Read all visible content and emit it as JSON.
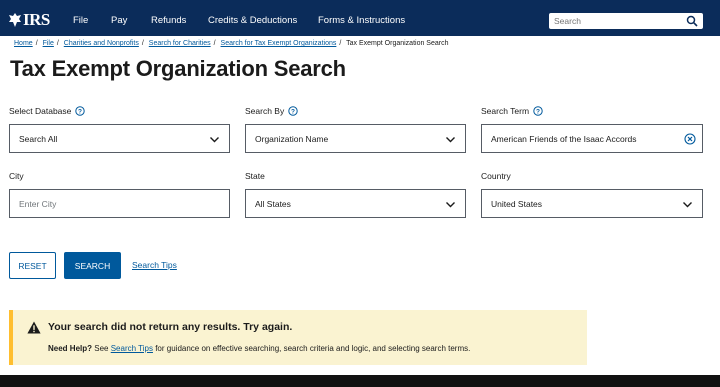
{
  "nav": {
    "logo": "IRS",
    "items": [
      "File",
      "Pay",
      "Refunds",
      "Credits & Deductions",
      "Forms & Instructions"
    ],
    "search_placeholder": "Search"
  },
  "breadcrumb": {
    "items": [
      "Home",
      "File",
      "Charities and Nonprofits",
      "Search for Charities",
      "Search for Tax Exempt Organizations"
    ],
    "current": "Tax Exempt Organization Search"
  },
  "page_title": "Tax Exempt Organization Search",
  "form": {
    "select_database": {
      "label": "Select Database",
      "value": "Search All"
    },
    "search_by": {
      "label": "Search By",
      "value": "Organization Name"
    },
    "search_term": {
      "label": "Search Term",
      "value": "American Friends of the Isaac Accords"
    },
    "city": {
      "label": "City",
      "placeholder": "Enter City"
    },
    "state": {
      "label": "State",
      "value": "All States"
    },
    "country": {
      "label": "Country",
      "value": "United States"
    }
  },
  "buttons": {
    "reset": "RESET",
    "search": "SEARCH",
    "search_tips": "Search Tips"
  },
  "alert": {
    "heading": "Your search did not return any results. Try again.",
    "need_help": "Need Help?",
    "see": "See",
    "link": "Search Tips",
    "rest": "for guidance on effective searching, search criteria and logic, and selecting search terms."
  },
  "colors": {
    "nav_bg": "#0b2c5a",
    "primary": "#00599c",
    "alert_bg": "#faf3d1",
    "alert_border": "#ffbe2e"
  }
}
